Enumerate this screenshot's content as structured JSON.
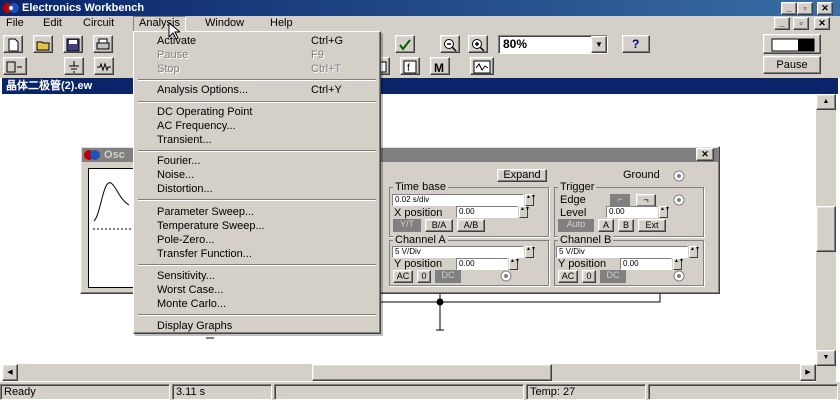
{
  "window": {
    "title": "Electronics Workbench"
  },
  "menubar": {
    "items": [
      "File",
      "Edit",
      "Circuit",
      "Analysis",
      "Window",
      "Help"
    ]
  },
  "toolbar": {
    "zoom_value": "80%",
    "pause_label": "Pause",
    "help_label": "?"
  },
  "circuit_window": {
    "title": "晶体二极管(2).ew"
  },
  "oscilloscope": {
    "title": "Osc",
    "expand_label": "Expand",
    "ground_label": "Ground",
    "timebase": {
      "label": "Time base",
      "value": "0.02 s/div",
      "xpos_label": "X position",
      "xpos_value": "0.00",
      "modes": [
        "Y/T",
        "B/A",
        "A/B"
      ]
    },
    "trigger": {
      "label": "Trigger",
      "edge_label": "Edge",
      "level_label": "Level",
      "level_value": "0.00",
      "modes": [
        "Auto",
        "A",
        "B",
        "Ext"
      ]
    },
    "channel_a": {
      "label": "Channel A",
      "value": "5 V/Div",
      "ypos_label": "Y position",
      "ypos_value": "0.00",
      "coupling": [
        "AC",
        "0",
        "DC"
      ]
    },
    "channel_b": {
      "label": "Channel B",
      "value": "5 V/Div",
      "ypos_label": "Y position",
      "ypos_value": "0.00",
      "coupling": [
        "AC",
        "0",
        "DC"
      ]
    }
  },
  "analysis_menu": {
    "items": [
      {
        "label": "Activate",
        "shortcut": "Ctrl+G"
      },
      {
        "label": "Pause",
        "shortcut": "F9"
      },
      {
        "label": "Stop",
        "shortcut": "Ctrl+T"
      },
      {
        "label": "Analysis Options...",
        "shortcut": "Ctrl+Y"
      },
      {
        "label": "DC Operating Point"
      },
      {
        "label": "AC Frequency..."
      },
      {
        "label": "Transient..."
      },
      {
        "label": "Fourier..."
      },
      {
        "label": "Noise..."
      },
      {
        "label": "Distortion..."
      },
      {
        "label": "Parameter Sweep..."
      },
      {
        "label": "Temperature Sweep..."
      },
      {
        "label": "Pole-Zero..."
      },
      {
        "label": "Transfer Function..."
      },
      {
        "label": "Sensitivity..."
      },
      {
        "label": "Worst Case..."
      },
      {
        "label": "Monte Carlo..."
      },
      {
        "label": "Display Graphs"
      }
    ]
  },
  "statusbar": {
    "status": "Ready",
    "time": "3.11 s",
    "temp": "Temp:  27"
  },
  "colors": {
    "titlebar": "#0a246a",
    "face": "#d4d0c8",
    "shadow": "#808080"
  }
}
